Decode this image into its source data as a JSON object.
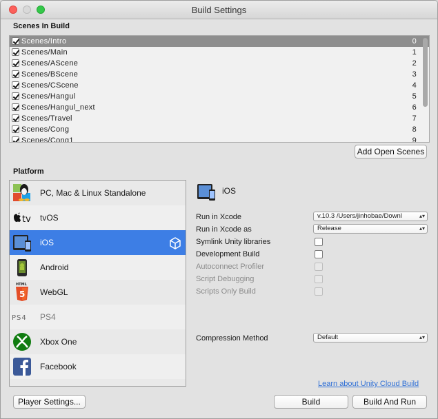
{
  "window": {
    "title": "Build Settings"
  },
  "scenes_section": {
    "label": "Scenes In Build",
    "scenes": [
      {
        "name": "Scenes/Intro",
        "index": "0",
        "checked": true,
        "selected": true
      },
      {
        "name": "Scenes/Main",
        "index": "1",
        "checked": true
      },
      {
        "name": "Scenes/AScene",
        "index": "2",
        "checked": true
      },
      {
        "name": "Scenes/BScene",
        "index": "3",
        "checked": true
      },
      {
        "name": "Scenes/CScene",
        "index": "4",
        "checked": true
      },
      {
        "name": "Scenes/Hangul",
        "index": "5",
        "checked": true
      },
      {
        "name": "Scenes/Hangul_next",
        "index": "6",
        "checked": true
      },
      {
        "name": "Scenes/Travel",
        "index": "7",
        "checked": true
      },
      {
        "name": "Scenes/Cong",
        "index": "8",
        "checked": true
      },
      {
        "name": "Scenes/Cong1",
        "index": "9",
        "checked": true
      }
    ],
    "add_open_scenes_label": "Add Open Scenes"
  },
  "platform_section": {
    "label": "Platform",
    "platforms": [
      {
        "label": "PC, Mac & Linux Standalone",
        "icon": "standalone-icon"
      },
      {
        "label": "tvOS",
        "icon": "appletv-icon"
      },
      {
        "label": "iOS",
        "icon": "ios-icon",
        "selected": true
      },
      {
        "label": "Android",
        "icon": "android-icon"
      },
      {
        "label": "WebGL",
        "icon": "html5-icon"
      },
      {
        "label": "PS4",
        "icon": "ps4-icon",
        "disabled": true
      },
      {
        "label": "Xbox One",
        "icon": "xbox-icon"
      },
      {
        "label": "Facebook",
        "icon": "facebook-icon"
      }
    ]
  },
  "ios_settings": {
    "header": "iOS",
    "run_in_xcode": {
      "label": "Run in Xcode",
      "value": "v.10.3   /Users/jinhobae/Downl"
    },
    "run_in_xcode_as": {
      "label": "Run in Xcode as",
      "value": "Release"
    },
    "symlink": {
      "label": "Symlink Unity libraries"
    },
    "development_build": {
      "label": "Development Build"
    },
    "autoconnect_profiler": {
      "label": "Autoconnect Profiler"
    },
    "script_debugging": {
      "label": "Script Debugging"
    },
    "scripts_only_build": {
      "label": "Scripts Only Build"
    },
    "compression": {
      "label": "Compression Method",
      "value": "Default"
    },
    "cloud_build_link": "Learn about Unity Cloud Build"
  },
  "footer": {
    "player_settings_label": "Player Settings...",
    "build_label": "Build",
    "build_and_run_label": "Build And Run"
  },
  "colors": {
    "selection_blue": "#3d7ee5",
    "selected_scene_gray": "#8e8e8e",
    "link_blue": "#2e6fd6"
  }
}
